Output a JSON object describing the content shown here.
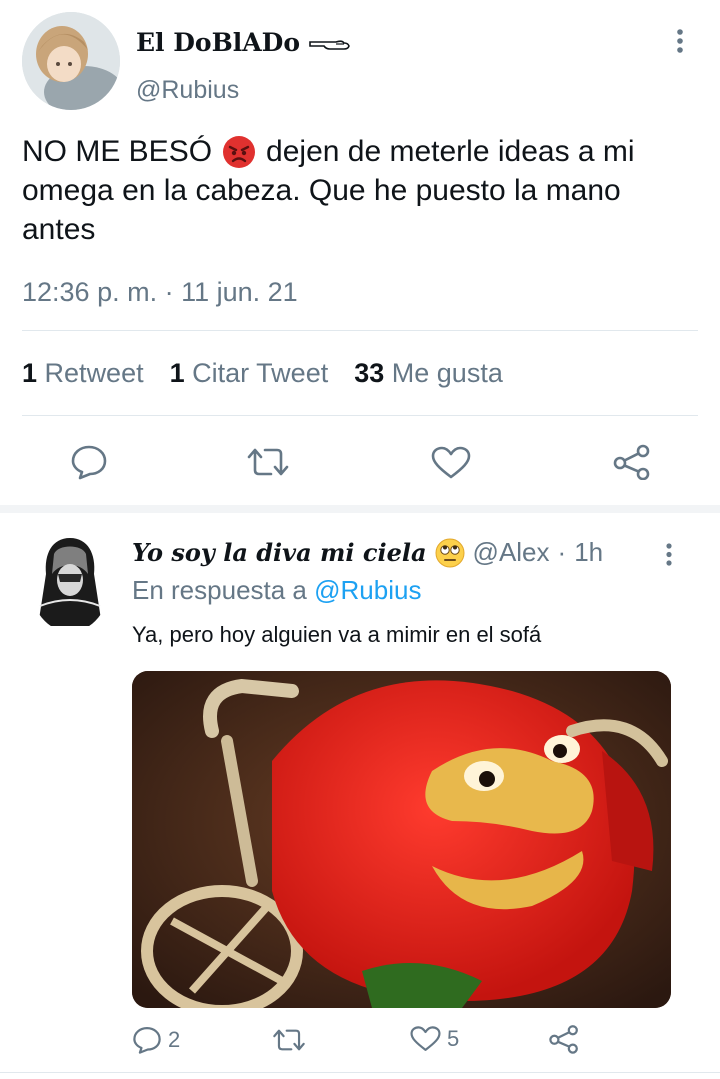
{
  "tweet": {
    "display_name": "El DoBlADo",
    "name_icon": "pointing-hand-icon",
    "handle": "@Rubius",
    "text_line1": "NO ME BESÓ",
    "emoji": "angry-face-emoji",
    "text_line1_rest": "dejen de meterle ideas a mi",
    "text_line2": "omega en la cabeza. Que he puesto la mano",
    "text_line3": "antes",
    "timestamp": "12:36 p. m. · 11 jun. 21",
    "stats": {
      "retweets_count": "1",
      "retweets_label": "Retweet",
      "quotes_count": "1",
      "quotes_label": "Citar Tweet",
      "likes_count": "33",
      "likes_label": "Me gusta"
    }
  },
  "reply": {
    "display_name": "Yo soy la diva mi ciela",
    "emoji": "rolling-eyes-emoji",
    "handle": "@Alex",
    "separator": "·",
    "time": "1h",
    "in_reply_prefix": "En respuesta a",
    "in_reply_handle": "@Rubius",
    "text": "Ya, pero hoy alguien va a mimir en el sofá",
    "replies_count": "2",
    "likes_count": "5"
  },
  "colors": {
    "accent": "#1da1f2",
    "muted": "#657786",
    "text": "#0f1419",
    "divider": "#e1e8ed"
  }
}
